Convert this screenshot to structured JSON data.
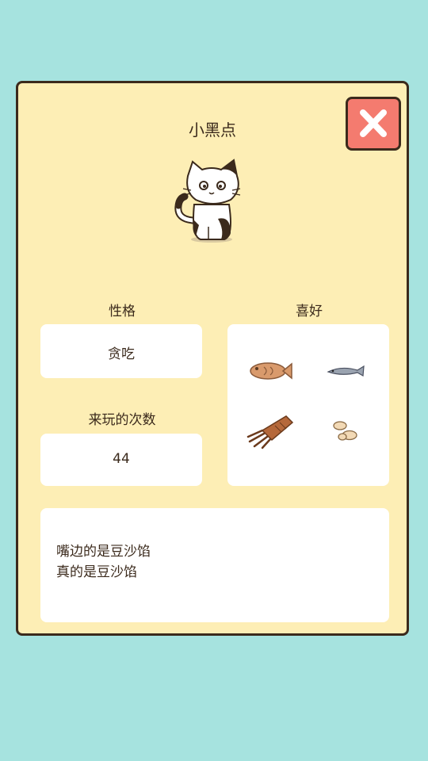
{
  "cat": {
    "name": "小黑点"
  },
  "personality": {
    "label": "性格",
    "value": "贪吃"
  },
  "visits": {
    "label": "来玩的次数",
    "value": "44"
  },
  "favorites": {
    "label": "喜好",
    "items": [
      "fish-cracker-icon",
      "sardine-icon",
      "dried-squid-icon",
      "peanuts-icon"
    ]
  },
  "message": {
    "lines": [
      "嘴边的是豆沙馅",
      "真的是豆沙馅"
    ]
  },
  "colors": {
    "background": "#a6e3df",
    "panel": "#fdeeb5",
    "close": "#f47b6f",
    "border": "#3b2a1c"
  }
}
